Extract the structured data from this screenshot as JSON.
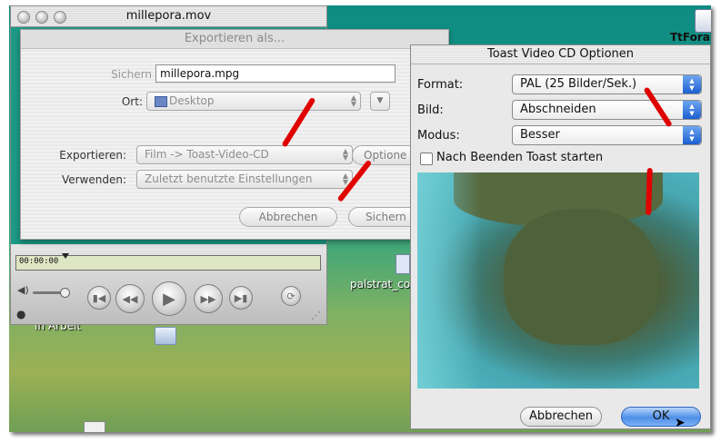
{
  "movie_window": {
    "title": "millepora.mov",
    "timecode": "00:00:00"
  },
  "export_sheet": {
    "title": "Exportieren als...",
    "save_as_label": "Sichern",
    "save_as_value": "millepora.mpg",
    "where_label": "Ort:",
    "where_value": "Desktop",
    "export_label": "Exportieren:",
    "export_value": "Film -> Toast-Video-CD",
    "options_button": "Optione",
    "use_label": "Verwenden:",
    "use_value": "Zuletzt benutzte Einstellungen",
    "cancel_button": "Abbrechen",
    "save_button": "Sichern"
  },
  "desktop": {
    "icon_labels": [
      "TtForar",
      "palstrat_co",
      "In Arbeit"
    ]
  },
  "toast_dialog": {
    "title": "Toast Video CD Optionen",
    "format_label": "Format:",
    "format_value": "PAL (25 Bilder/Sek.)",
    "image_label": "Bild:",
    "image_value": "Abschneiden",
    "mode_label": "Modus:",
    "mode_value": "Besser",
    "launch_checkbox_label": "Nach Beenden Toast starten",
    "launch_checked": false,
    "cancel_button": "Abbrechen",
    "ok_button": "OK"
  },
  "colors": {
    "annotation_arrow": "#e00000",
    "default_button": "#5b9af0"
  }
}
